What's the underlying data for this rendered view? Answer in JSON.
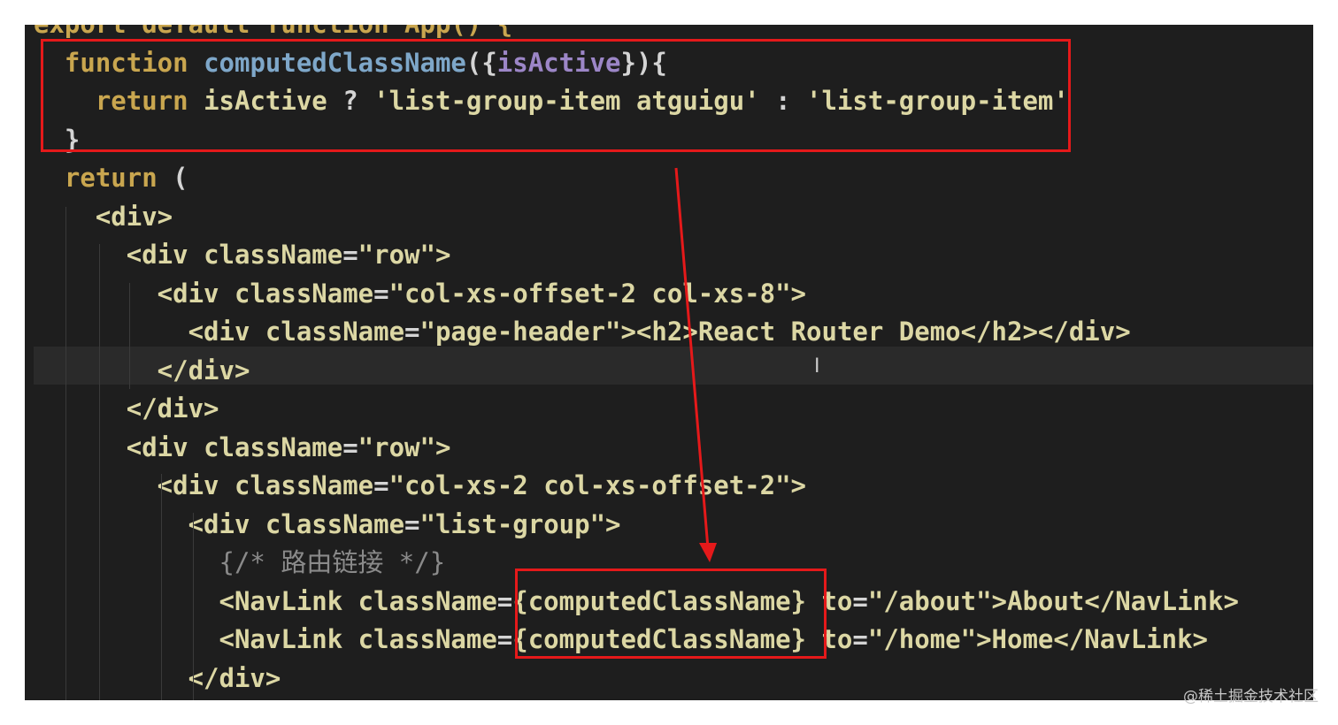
{
  "editor": {
    "lines": [
      [
        {
          "t": "export default function App() {",
          "c": "kw"
        }
      ],
      [
        {
          "t": "  function ",
          "c": "kw"
        },
        {
          "t": "computedClassName",
          "c": "fn"
        },
        {
          "t": "({",
          "c": "punc"
        },
        {
          "t": "isActive",
          "c": "param"
        },
        {
          "t": "}){",
          "c": "punc"
        }
      ],
      [
        {
          "t": "    return ",
          "c": "kw"
        },
        {
          "t": "isActive",
          "c": "ident"
        },
        {
          "t": " ? ",
          "c": "punc"
        },
        {
          "t": "'list-group-item atguigu'",
          "c": "str"
        },
        {
          "t": " : ",
          "c": "punc"
        },
        {
          "t": "'list-group-item'",
          "c": "str"
        }
      ],
      [
        {
          "t": "  }",
          "c": "punc"
        }
      ],
      [
        {
          "t": "  return ",
          "c": "kw"
        },
        {
          "t": "(",
          "c": "punc"
        }
      ],
      [
        {
          "t": "    <div>",
          "c": "tag"
        }
      ],
      [
        {
          "t": "      <div ",
          "c": "tag"
        },
        {
          "t": "className",
          "c": "attr"
        },
        {
          "t": "=",
          "c": "punc"
        },
        {
          "t": "\"row\"",
          "c": "str"
        },
        {
          "t": ">",
          "c": "tag"
        }
      ],
      [
        {
          "t": "        <div ",
          "c": "tag"
        },
        {
          "t": "className",
          "c": "attr"
        },
        {
          "t": "=",
          "c": "punc"
        },
        {
          "t": "\"col-xs-offset-2 col-xs-8\"",
          "c": "str"
        },
        {
          "t": ">",
          "c": "tag"
        }
      ],
      [
        {
          "t": "          <div ",
          "c": "tag"
        },
        {
          "t": "className",
          "c": "attr"
        },
        {
          "t": "=",
          "c": "punc"
        },
        {
          "t": "\"page-header\"",
          "c": "str"
        },
        {
          "t": "><h2>",
          "c": "tag"
        },
        {
          "t": "React Router Demo",
          "c": "ident"
        },
        {
          "t": "</h2></div>",
          "c": "tag"
        }
      ],
      [
        {
          "t": "        </div>",
          "c": "tag"
        }
      ],
      [
        {
          "t": "      </div>",
          "c": "tag"
        }
      ],
      [
        {
          "t": "      <div ",
          "c": "tag"
        },
        {
          "t": "className",
          "c": "attr"
        },
        {
          "t": "=",
          "c": "punc"
        },
        {
          "t": "\"row\"",
          "c": "str"
        },
        {
          "t": ">",
          "c": "tag"
        }
      ],
      [
        {
          "t": "        <div ",
          "c": "tag"
        },
        {
          "t": "className",
          "c": "attr"
        },
        {
          "t": "=",
          "c": "punc"
        },
        {
          "t": "\"col-xs-2 col-xs-offset-2\"",
          "c": "str"
        },
        {
          "t": ">",
          "c": "tag"
        }
      ],
      [
        {
          "t": "          <div ",
          "c": "tag"
        },
        {
          "t": "className",
          "c": "attr"
        },
        {
          "t": "=",
          "c": "punc"
        },
        {
          "t": "\"list-group\"",
          "c": "str"
        },
        {
          "t": ">",
          "c": "tag"
        }
      ],
      [
        {
          "t": "            {/* 路由链接 */}",
          "c": "comment"
        }
      ],
      [
        {
          "t": "            <NavLink ",
          "c": "tag"
        },
        {
          "t": "className",
          "c": "attr"
        },
        {
          "t": "=",
          "c": "punc"
        },
        {
          "t": "{computedClassName}",
          "c": "ident"
        },
        {
          "t": " to",
          "c": "attr"
        },
        {
          "t": "=",
          "c": "punc"
        },
        {
          "t": "\"/about\"",
          "c": "str"
        },
        {
          "t": ">",
          "c": "tag"
        },
        {
          "t": "About",
          "c": "ident"
        },
        {
          "t": "</NavLink>",
          "c": "tag"
        }
      ],
      [
        {
          "t": "            <NavLink ",
          "c": "tag"
        },
        {
          "t": "className",
          "c": "attr"
        },
        {
          "t": "=",
          "c": "punc"
        },
        {
          "t": "{computedClassName}",
          "c": "ident"
        },
        {
          "t": " to",
          "c": "attr"
        },
        {
          "t": "=",
          "c": "punc"
        },
        {
          "t": "\"/home\"",
          "c": "str"
        },
        {
          "t": ">",
          "c": "tag"
        },
        {
          "t": "Home",
          "c": "ident"
        },
        {
          "t": "</NavLink>",
          "c": "tag"
        }
      ],
      [
        {
          "t": "          </div>",
          "c": "tag"
        }
      ]
    ]
  },
  "watermark": "@稀土掘金技术社区",
  "colors": {
    "annotation": "#e5191a",
    "background": "#1e1e1e"
  }
}
